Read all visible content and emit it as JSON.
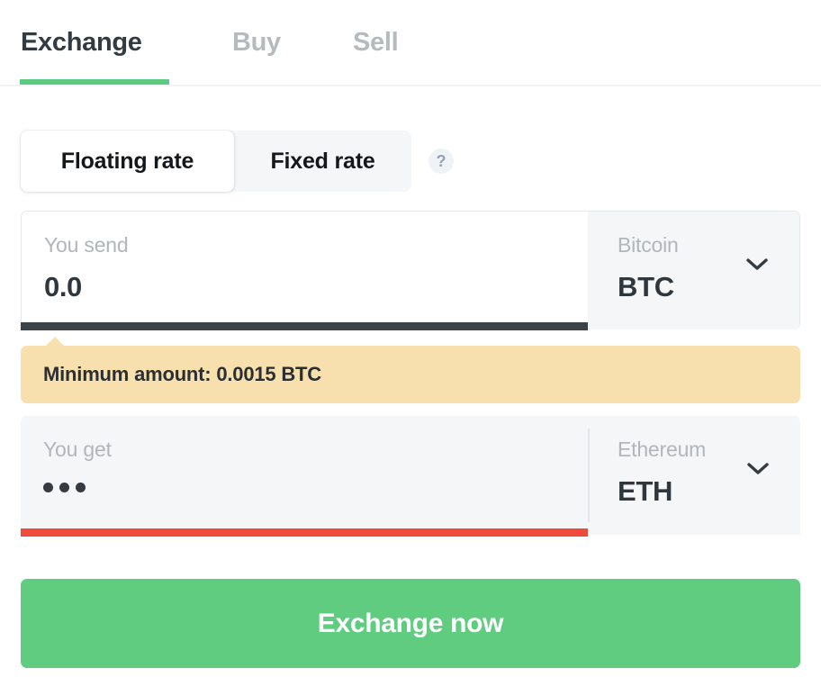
{
  "tabs": [
    {
      "label": "Exchange",
      "active": true
    },
    {
      "label": "Buy",
      "active": false
    },
    {
      "label": "Sell",
      "active": false
    }
  ],
  "rate_toggle": {
    "floating_label": "Floating rate",
    "fixed_label": "Fixed rate",
    "selected": "Floating rate",
    "help_icon": "question-mark-icon",
    "help_glyph": "?"
  },
  "send_field": {
    "label": "You send",
    "value": "0.0",
    "placeholder": "0.0",
    "currency_name": "Bitcoin",
    "currency_ticker": "BTC",
    "chevron_icon": "chevron-down-icon"
  },
  "warning": {
    "text": "Minimum amount: 0.0015 BTC"
  },
  "get_field": {
    "label": "You get",
    "value": "•••",
    "loading": true,
    "currency_name": "Ethereum",
    "currency_ticker": "ETH",
    "chevron_icon": "chevron-down-icon"
  },
  "cta": {
    "label": "Exchange now"
  },
  "colors": {
    "accent_green": "#60cc80",
    "tab_underline_green": "#5fca84",
    "warning_bg": "#f7dfae",
    "error_red": "#ef4b3c",
    "focus_dark": "#3c4348",
    "field_gray": "#f4f6f8",
    "text_dark": "#2f373d",
    "text_muted": "#b0b6bc"
  }
}
